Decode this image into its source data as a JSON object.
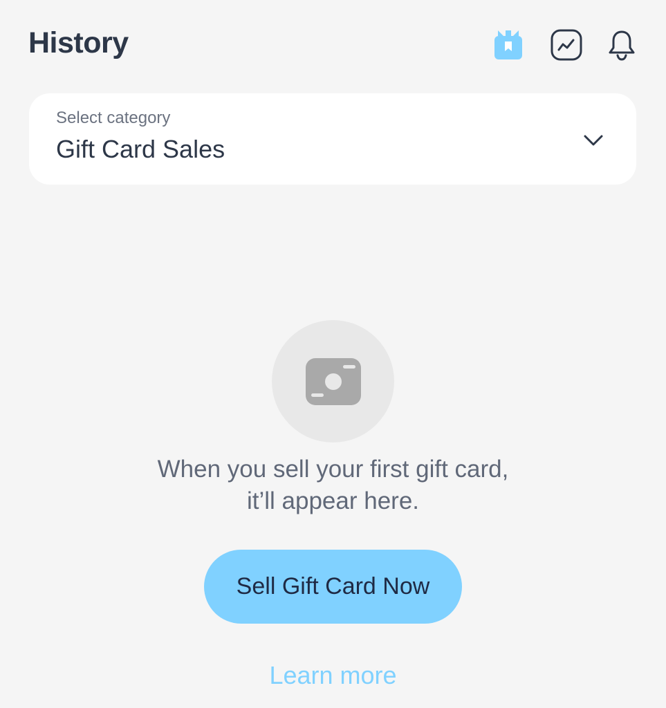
{
  "header": {
    "title": "History",
    "icons": [
      "gift-icon",
      "chart-icon",
      "bell-icon"
    ]
  },
  "category_select": {
    "label": "Select category",
    "value": "Gift Card Sales"
  },
  "empty_state": {
    "icon": "card-photo-icon",
    "line1": "When you sell your first gift card,",
    "line2": "it’ll appear here."
  },
  "actions": {
    "primary_label": "Sell Gift Card Now",
    "link_label": "Learn more"
  },
  "colors": {
    "accent": "#80d1ff",
    "background": "#f5f5f5",
    "text_dark": "#2d3748"
  }
}
